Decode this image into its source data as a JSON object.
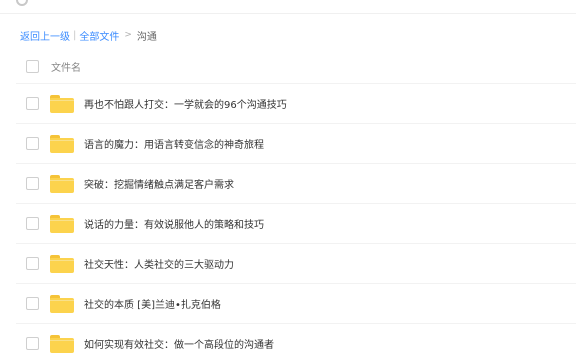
{
  "breadcrumb": {
    "back": "返回上一级",
    "separator": "|",
    "all_files": "全部文件",
    "arrow": ">",
    "current": "沟通"
  },
  "list": {
    "header": "文件名",
    "items": [
      {
        "name": "再也不怕跟人打交：一学就会的96个沟通技巧",
        "icon": "folder-icon"
      },
      {
        "name": "语言的魔力：用语言转变信念的神奇旅程",
        "icon": "folder-icon"
      },
      {
        "name": "突破：挖掘情绪触点满足客户需求",
        "icon": "folder-icon"
      },
      {
        "name": "说话的力量：有效说服他人的策略和技巧",
        "icon": "folder-icon"
      },
      {
        "name": "社交天性：人类社交的三大驱动力",
        "icon": "folder-icon"
      },
      {
        "name": "社交的本质 [美]兰迪•扎克伯格",
        "icon": "folder-icon"
      },
      {
        "name": "如何实现有效社交：做一个高段位的沟通者",
        "icon": "folder-icon"
      }
    ]
  },
  "colors": {
    "link": "#3b8cff",
    "folder": "#fcd34d",
    "text": "#333333"
  }
}
